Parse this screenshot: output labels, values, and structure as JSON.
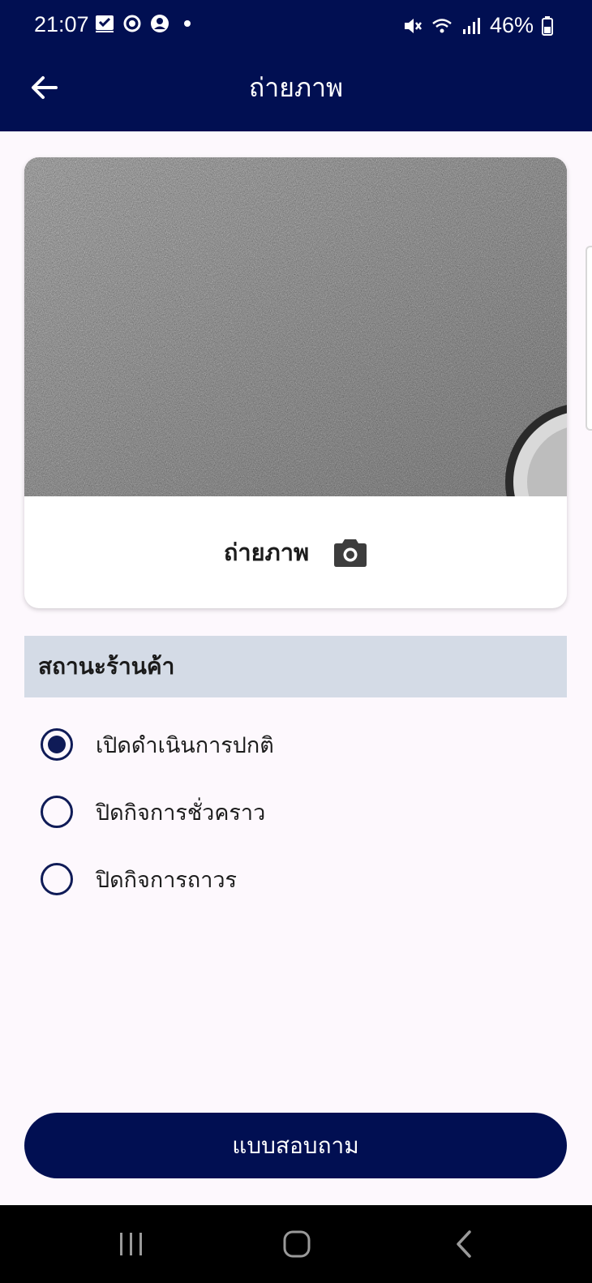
{
  "status_bar": {
    "time": "21:07",
    "battery_percent": "46%",
    "left_icons": [
      "checkbox-notification-icon",
      "sync-icon",
      "account-icon",
      "dot-icon"
    ],
    "right_icons": [
      "mute-icon",
      "wifi-icon",
      "signal-icon",
      "battery-icon"
    ]
  },
  "app_bar": {
    "title": "ถ่ายภาพ",
    "back_icon": "arrow-left-icon"
  },
  "photo_card": {
    "capture_label": "ถ่ายภาพ",
    "capture_icon": "camera-icon"
  },
  "store_status": {
    "title": "สถานะร้านค้า",
    "options": [
      {
        "label": "เปิดดำเนินการปกติ",
        "selected": true
      },
      {
        "label": "ปิดกิจการชั่วคราว",
        "selected": false
      },
      {
        "label": "ปิดกิจการถาวร",
        "selected": false
      }
    ]
  },
  "survey_button": {
    "label": "แบบสอบถาม"
  },
  "nav_bar": {
    "icons": [
      "recent-apps-icon",
      "home-icon",
      "back-icon"
    ]
  },
  "colors": {
    "primary": "#010f52",
    "section_header_bg": "#d4dbe6",
    "page_bg": "#fdf8fd",
    "radio": "#0f1b57"
  }
}
